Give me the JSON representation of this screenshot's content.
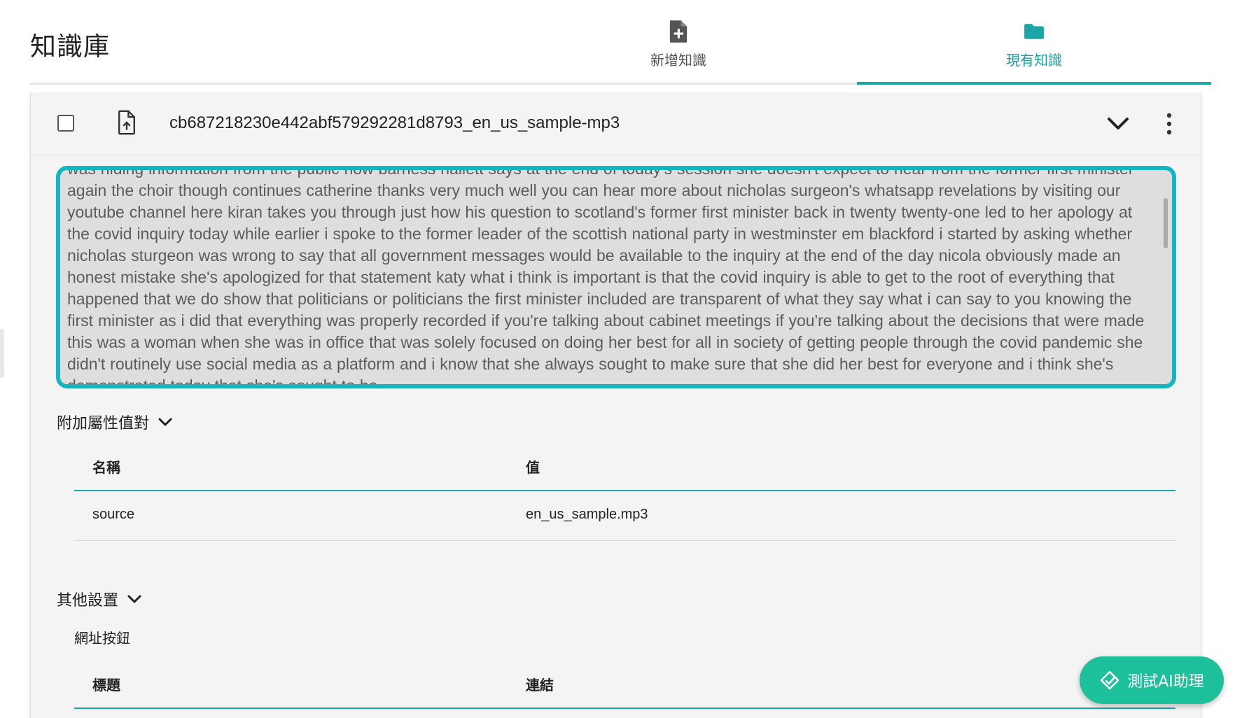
{
  "app": {
    "title": "知識庫"
  },
  "tabs": [
    {
      "label": "新增知識",
      "icon": "file-plus-icon",
      "active": false
    },
    {
      "label": "現有知識",
      "icon": "folder-icon",
      "active": true
    }
  ],
  "colors": {
    "accent": "#1aa6a6",
    "focus_border": "#13b5c2",
    "fab": "#1cc19c"
  },
  "document": {
    "name": "cb687218230e442abf579292281d8793_en_us_sample-mp3",
    "content_text": "was hiding information from the public now barness hallett says at the end of today's session she doesn't expect to hear from the former first minister again the choir though continues catherine thanks very much well you can hear more about nicholas surgeon's whatsapp revelations by visiting our youtube channel here kiran takes you through just how his question to scotland's former first minister back in twenty twenty-one led to her apology at the covid inquiry today  while earlier i spoke to the former leader of the scottish national party in westminster em blackford i started by asking whether nicholas sturgeon was wrong to say that all government messages would be available to the inquiry at the end of the day nicola obviously made an honest mistake she's apologized for that statement katy what i think is important is that the covid inquiry is able to get to the root of everything that happened that we do show that politicians or politicians the first minister included are transparent of what they say what i can say to you knowing the first minister as i did that everything was properly recorded if you're talking about cabinet meetings if you're talking about the decisions that were made this was a woman when she was in office that was solely focused on doing her best for all in society of getting people through the covid pandemic she didn't routinely use social media as a platform and i know that she always sought to make sure that she did her best for everyone and i think she's demonstrated today that she's sought to be"
  },
  "attributes": {
    "section_label": "附加屬性值對",
    "header_name": "名稱",
    "header_value": "值",
    "rows": [
      {
        "name": "source",
        "value": "en_us_sample.mp3"
      }
    ]
  },
  "other_settings": {
    "section_label": "其他設置",
    "url_button_label": "網址按鈕",
    "header_title": "標題",
    "header_link": "連結"
  },
  "fab": {
    "label": "測試AI助理",
    "icon": "assistant-icon"
  }
}
